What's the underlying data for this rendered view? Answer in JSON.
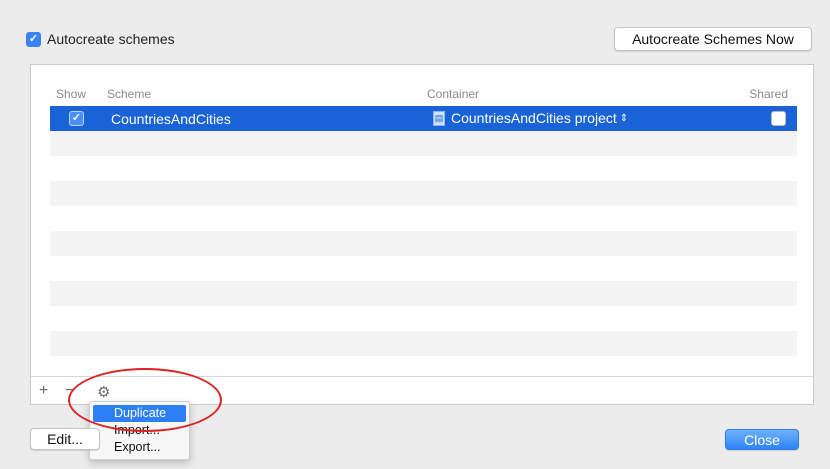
{
  "options": {
    "autocreate_label": "Autocreate schemes",
    "autocreate_checked": true,
    "autocreate_now_label": "Autocreate Schemes Now"
  },
  "table": {
    "headers": {
      "show": "Show",
      "scheme": "Scheme",
      "container": "Container",
      "shared": "Shared"
    },
    "rows": [
      {
        "show_checked": true,
        "scheme": "CountriesAndCities",
        "container": "CountriesAndCities project",
        "shared_checked": false,
        "selected": true
      }
    ]
  },
  "toolbar": {
    "add_icon": "plus-icon",
    "remove_icon": "minus-icon",
    "actions_icon": "gear-icon"
  },
  "context_menu": {
    "items": [
      {
        "label": "Duplicate",
        "highlighted": true
      },
      {
        "label": "Import...",
        "highlighted": false
      },
      {
        "label": "Export...",
        "highlighted": false
      }
    ]
  },
  "footer": {
    "edit_label": "Edit...",
    "close_label": "Close"
  },
  "colors": {
    "selection": "#1a63d6",
    "accent": "#3b82f6",
    "annotation": "#dd2424"
  }
}
